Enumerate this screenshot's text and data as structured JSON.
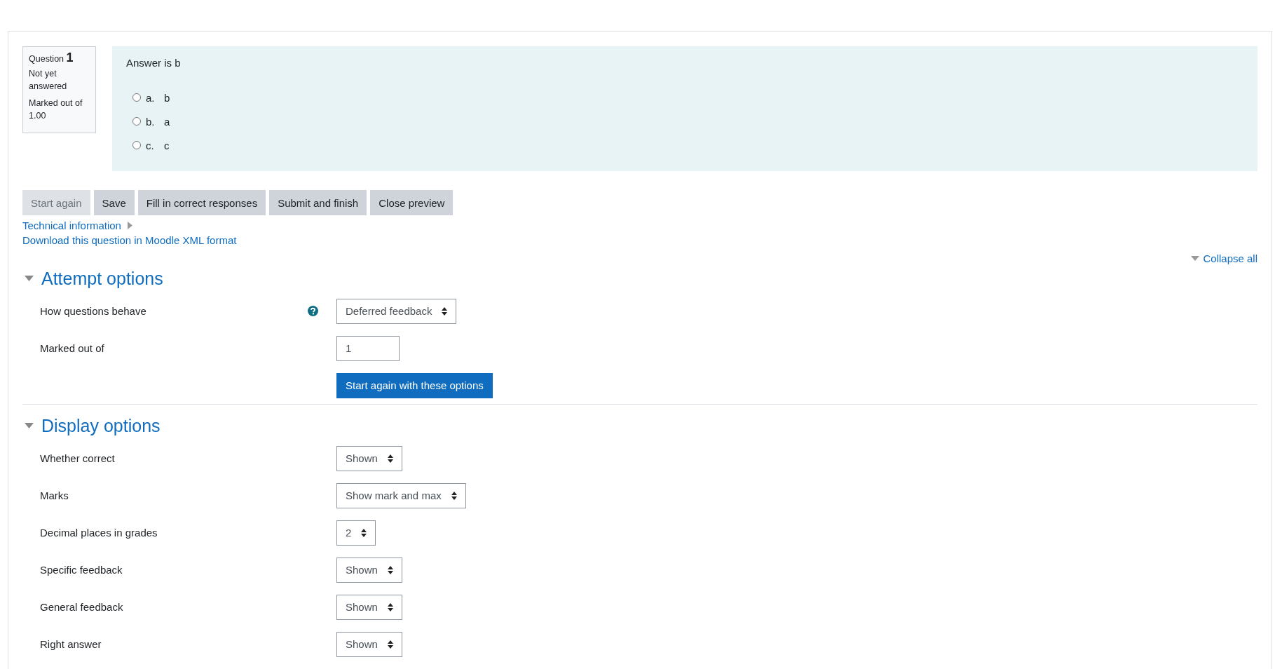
{
  "question_info": {
    "label": "Question",
    "number": "1",
    "state": "Not yet answered",
    "grade": "Marked out of 1.00"
  },
  "question": {
    "text": "Answer is b",
    "options": [
      {
        "letter": "a.",
        "text": "b",
        "selected": false
      },
      {
        "letter": "b.",
        "text": "a",
        "selected": false
      },
      {
        "letter": "c.",
        "text": "c",
        "selected": false
      }
    ]
  },
  "buttons": [
    {
      "label": "Start again",
      "disabled": true
    },
    {
      "label": "Save",
      "disabled": false
    },
    {
      "label": "Fill in correct responses",
      "disabled": false
    },
    {
      "label": "Submit and finish",
      "disabled": false
    },
    {
      "label": "Close preview",
      "disabled": false
    }
  ],
  "technical_info": {
    "label": "Technical information",
    "expanded": false
  },
  "download_link": "Download this question in Moodle XML format",
  "collapse_all": "Collapse all",
  "sections": [
    {
      "title": "Attempt options",
      "expanded": true,
      "fields": [
        {
          "kind": "select",
          "label": "How questions behave",
          "help": true,
          "value": "Deferred feedback"
        },
        {
          "kind": "text",
          "label": "Marked out of",
          "value": "1"
        },
        {
          "kind": "button",
          "label": "Start again with these options"
        }
      ]
    },
    {
      "title": "Display options",
      "expanded": true,
      "fields": [
        {
          "kind": "select",
          "label": "Whether correct",
          "value": "Shown"
        },
        {
          "kind": "select",
          "label": "Marks",
          "value": "Show mark and max"
        },
        {
          "kind": "select",
          "label": "Decimal places in grades",
          "value": "2"
        },
        {
          "kind": "select",
          "label": "Specific feedback",
          "value": "Shown"
        },
        {
          "kind": "select",
          "label": "General feedback",
          "value": "Shown"
        },
        {
          "kind": "select",
          "label": "Right answer",
          "value": "Shown"
        }
      ]
    }
  ]
}
